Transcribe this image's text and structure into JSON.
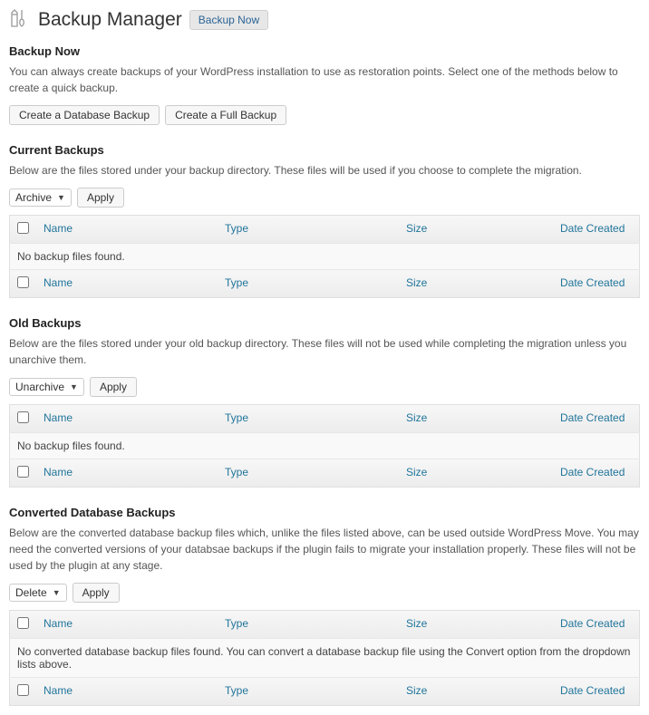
{
  "page": {
    "title": "Backup Manager",
    "titleButton": "Backup Now"
  },
  "sections": {
    "backupNow": {
      "heading": "Backup Now",
      "desc": "You can always create backups of your WordPress installation to use as restoration points. Select one of the methods below to create a quick backup.",
      "buttons": {
        "db": "Create a Database Backup",
        "full": "Create a Full Backup"
      }
    },
    "current": {
      "heading": "Current Backups",
      "desc": "Below are the files stored under your backup directory. These files will be used if you choose to complete the migration.",
      "action": "Archive",
      "apply": "Apply",
      "empty": "No backup files found."
    },
    "old": {
      "heading": "Old Backups",
      "desc": "Below are the files stored under your old backup directory. These files will not be used while completing the migration unless you unarchive them.",
      "action": "Unarchive",
      "apply": "Apply",
      "empty": "No backup files found."
    },
    "converted": {
      "heading": "Converted Database Backups",
      "desc": "Below are the converted database backup files which, unlike the files listed above, can be used outside WordPress Move. You may need the converted versions of your databsae backups if the plugin fails to migrate your installation properly. These files will not be used by the plugin at any stage.",
      "action": "Delete",
      "apply": "Apply",
      "empty": "No converted database backup files found. You can convert a database backup file using the Convert option from the dropdown lists above."
    }
  },
  "columns": {
    "name": "Name",
    "type": "Type",
    "size": "Size",
    "date": "Date Created"
  }
}
